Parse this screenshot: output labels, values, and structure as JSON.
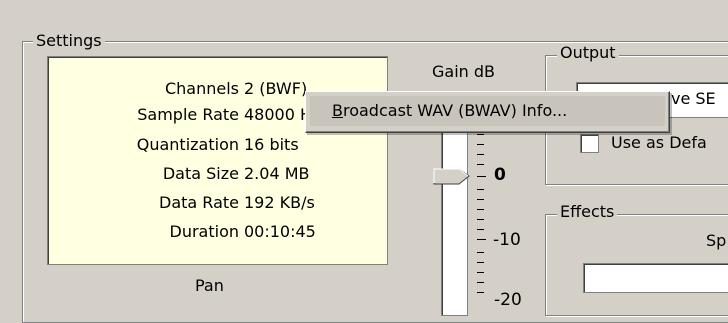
{
  "settings": {
    "title": "Settings",
    "info": [
      {
        "label": "Channels",
        "value": "2 (BWF)"
      },
      {
        "label": "Sample Rate",
        "value": "48000 H"
      },
      {
        "label": "Quantization",
        "value": "16 bits"
      },
      {
        "label": "Data Size",
        "value": "2.04 MB"
      },
      {
        "label": "Data Rate",
        "value": "192 KB/s"
      },
      {
        "label": "Duration",
        "value": "00:10:45"
      }
    ],
    "pan_label": "Pan"
  },
  "gain": {
    "label": "Gain dB",
    "tick_0": "0",
    "tick_minus10": "-10",
    "tick_minus20": "-20"
  },
  "output": {
    "title": "Output",
    "device_value": "ve SE",
    "use_default_label": "Use as Defa"
  },
  "effects": {
    "title": "Effects",
    "speed_label": "Sp"
  },
  "context_menu": {
    "item_first_letter": "B",
    "item_rest": "roadcast WAV (BWAV) Info..."
  }
}
